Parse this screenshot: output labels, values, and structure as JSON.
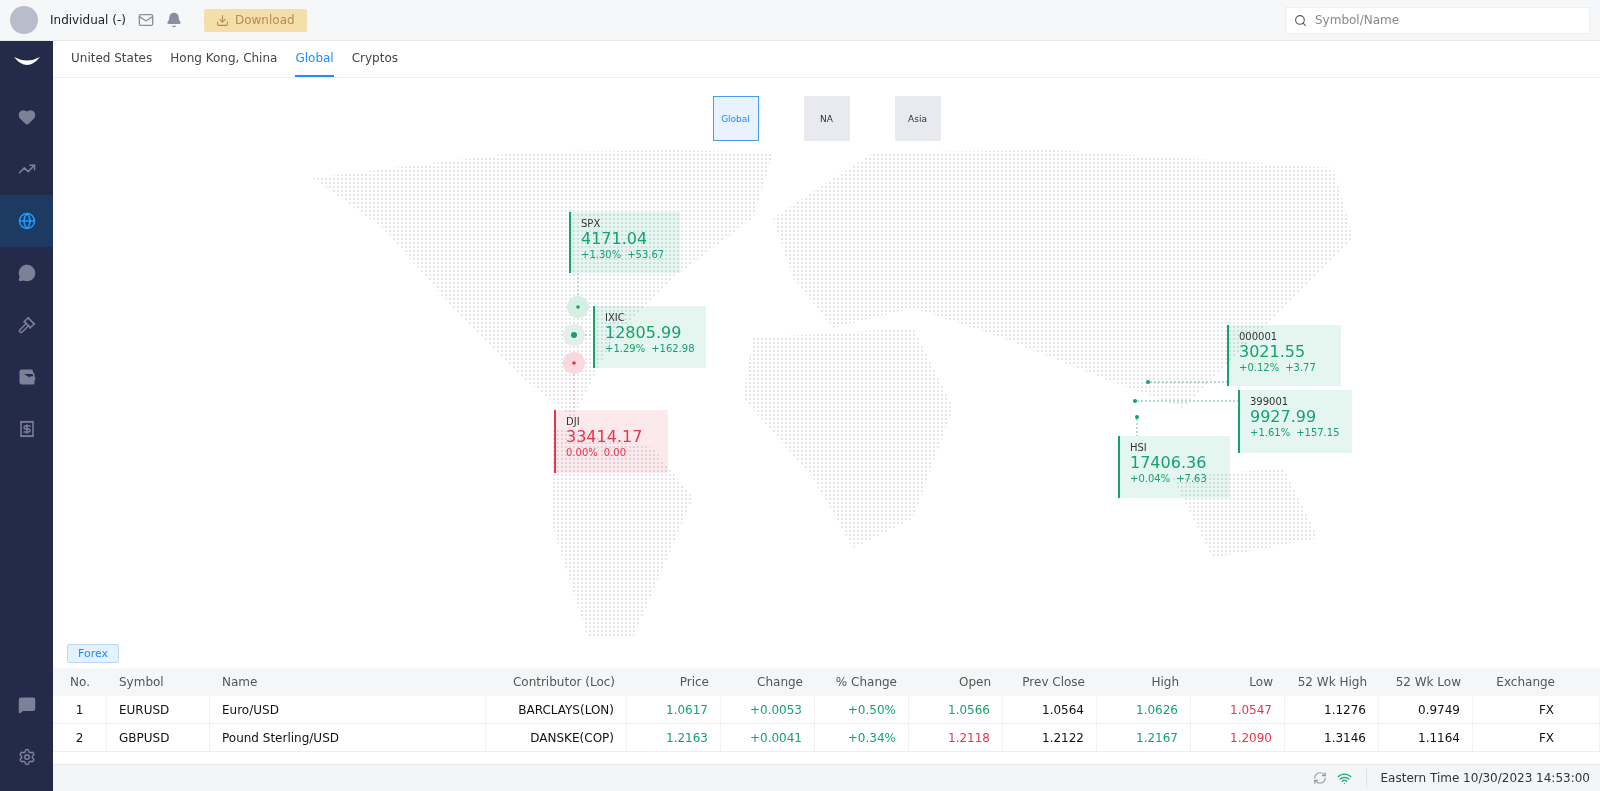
{
  "header": {
    "account": "Individual (-)",
    "download": "Download",
    "search": {
      "placeholder": "Symbol/Name"
    }
  },
  "sidebar": {
    "items": [
      {
        "selected": false
      },
      {
        "selected": false
      },
      {
        "selected": true
      },
      {
        "selected": false
      },
      {
        "selected": false
      },
      {
        "selected": false
      },
      {
        "selected": false
      }
    ]
  },
  "tabs": [
    {
      "label": "United States",
      "selected": false
    },
    {
      "label": "Hong Kong, China",
      "selected": false
    },
    {
      "label": "Global",
      "selected": true
    },
    {
      "label": "Cryptos",
      "selected": false
    }
  ],
  "regions": [
    {
      "label": "Global",
      "selected": true
    },
    {
      "label": "NA",
      "selected": false
    },
    {
      "label": "Asia",
      "selected": false
    }
  ],
  "indices": [
    {
      "symbol": "SPX",
      "price": "4171.04",
      "pct": "+1.30%",
      "change": "+53.67",
      "color": "#14a36a"
    },
    {
      "symbol": "IXIC",
      "price": "12805.99",
      "pct": "+1.29%",
      "change": "+162.98",
      "color": "#14a36a"
    },
    {
      "symbol": "DJI",
      "price": "33414.17",
      "pct": "0.00%",
      "change": "0.00",
      "color": "#e8344e"
    },
    {
      "symbol": "000001",
      "price": "3021.55",
      "pct": "+0.12%",
      "change": "+3.77",
      "color": "#14a36a"
    },
    {
      "symbol": "399001",
      "price": "9927.99",
      "pct": "+1.61%",
      "change": "+157.15",
      "color": "#14a36a"
    },
    {
      "symbol": "HSI",
      "price": "17406.36",
      "pct": "+0.04%",
      "change": "+7.63",
      "color": "#14a36a"
    }
  ],
  "forex": {
    "tag": "Forex",
    "columns": [
      "No.",
      "Symbol",
      "Name",
      "Contributor (Loc)",
      "Price",
      "Change",
      "% Change",
      "Open",
      "Prev Close",
      "High",
      "Low",
      "52 Wk High",
      "52 Wk Low",
      "Exchange"
    ],
    "rows": [
      {
        "cells": [
          {
            "text": "1",
            "color": "#111111"
          },
          {
            "text": "EURUSD",
            "color": "#111111"
          },
          {
            "text": "Euro/USD",
            "color": "#111111"
          },
          {
            "text": "BARCLAYS(LON)",
            "color": "#111111"
          },
          {
            "text": "1.0617",
            "color": "#14a36a"
          },
          {
            "text": "+0.0053",
            "color": "#14a36a"
          },
          {
            "text": "+0.50%",
            "color": "#14a36a"
          },
          {
            "text": "1.0566",
            "color": "#14a36a"
          },
          {
            "text": "1.0564",
            "color": "#111111"
          },
          {
            "text": "1.0626",
            "color": "#14a36a"
          },
          {
            "text": "1.0547",
            "color": "#e8344e"
          },
          {
            "text": "1.1276",
            "color": "#111111"
          },
          {
            "text": "0.9749",
            "color": "#111111"
          },
          {
            "text": "FX",
            "color": "#111111"
          }
        ]
      },
      {
        "cells": [
          {
            "text": "2",
            "color": "#111111"
          },
          {
            "text": "GBPUSD",
            "color": "#111111"
          },
          {
            "text": "Pound Sterling/USD",
            "color": "#111111"
          },
          {
            "text": "DANSKE(COP)",
            "color": "#111111"
          },
          {
            "text": "1.2163",
            "color": "#14a36a"
          },
          {
            "text": "+0.0041",
            "color": "#14a36a"
          },
          {
            "text": "+0.34%",
            "color": "#14a36a"
          },
          {
            "text": "1.2118",
            "color": "#e8344e"
          },
          {
            "text": "1.2122",
            "color": "#111111"
          },
          {
            "text": "1.2167",
            "color": "#14a36a"
          },
          {
            "text": "1.2090",
            "color": "#e8344e"
          },
          {
            "text": "1.3146",
            "color": "#111111"
          },
          {
            "text": "1.1164",
            "color": "#111111"
          },
          {
            "text": "FX",
            "color": "#111111"
          }
        ]
      }
    ]
  },
  "status_bar": {
    "time": "Eastern Time 10/30/2023 14:53:00"
  }
}
